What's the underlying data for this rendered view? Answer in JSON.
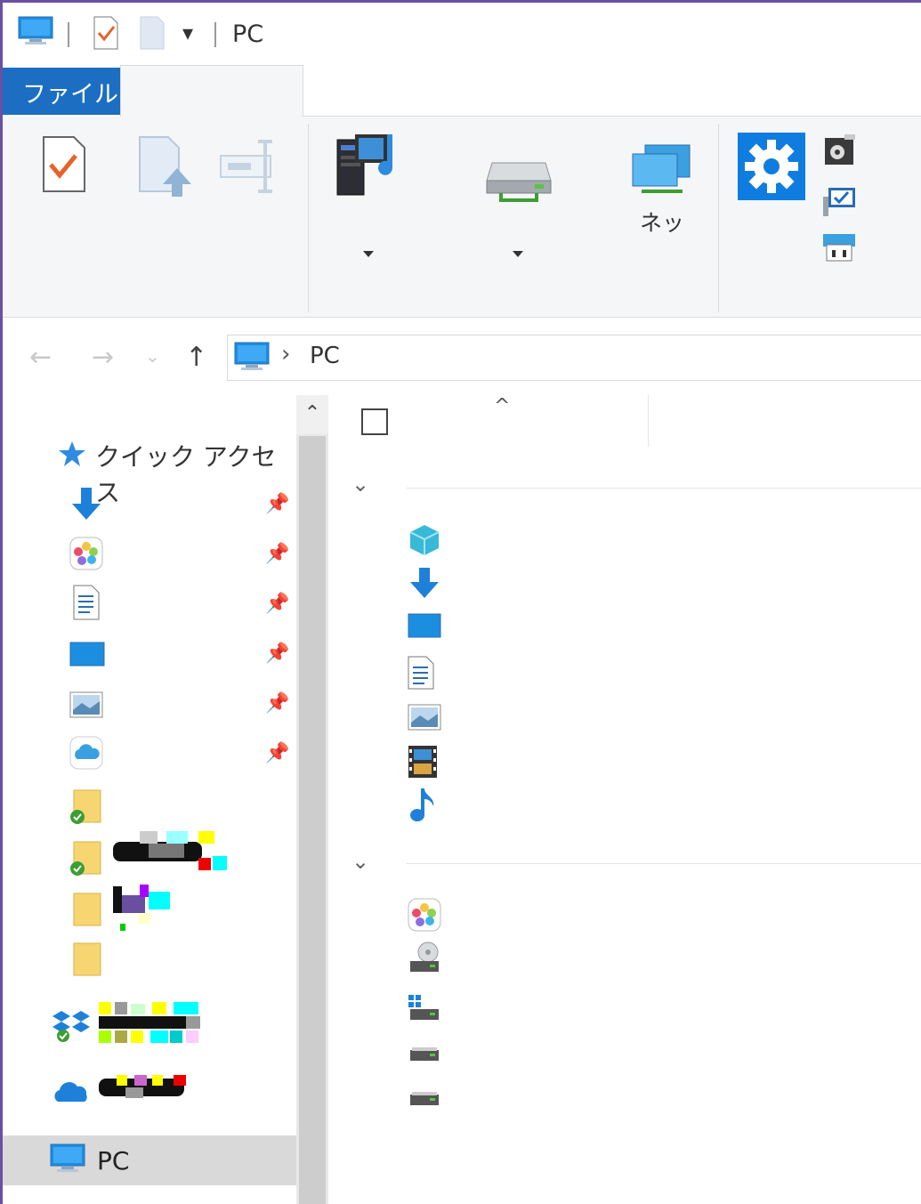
{
  "window": {
    "title": "PC"
  },
  "qat": {
    "customize_glyph": "▾"
  },
  "ribbon": {
    "file_tab": "ファイル",
    "network_label": "ネッ",
    "icons": [
      "properties-icon",
      "open-icon",
      "rename-icon",
      "media-access-icon",
      "map-drive-icon",
      "network-location-icon",
      "settings-icon",
      "uninstall-icon",
      "system-properties-icon",
      "manage-icon"
    ]
  },
  "nav": {
    "back": "←",
    "forward": "→",
    "recent": "⌄",
    "up": "↑",
    "address_sep": "›",
    "address_text": "PC"
  },
  "left_pane": {
    "quick_access_label": "クイック アクセス",
    "pin_glyph": "📌",
    "pc_label": "PC",
    "quick_items": [
      "downloads-icon",
      "photos-icon",
      "documents-icon",
      "desktop-icon",
      "pictures-icon",
      "icloud-icon",
      "folder-synced-icon",
      "folder-synced-icon",
      "folder-icon",
      "folder-icon"
    ]
  },
  "scroll": {
    "up_glyph": "⌃"
  },
  "right_pane": {
    "sort_glyph": "^",
    "chevron_glyph": "⌄",
    "folders": [
      "3d-objects-icon",
      "downloads-icon",
      "desktop-icon",
      "documents-icon",
      "pictures-icon",
      "videos-icon",
      "music-icon"
    ],
    "devices": [
      "icloud-photos-icon",
      "dvd-drive-icon",
      "windows-drive-icon",
      "drive-icon",
      "drive-icon"
    ]
  },
  "colors": {
    "accent": "#1b6ec2",
    "selection": "#d9d9d9",
    "window_border": "#6b4fa3"
  }
}
